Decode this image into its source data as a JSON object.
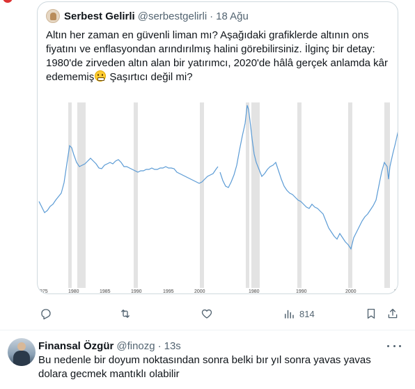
{
  "quoted_tweet": {
    "display_name": "Serbest Gelirli",
    "handle": "@serbestgelirli",
    "separator": "·",
    "date": "18 Ağu",
    "text_part1": "Altın her zaman en güvenli liman mı? Aşağıdaki grafiklerde altının ons fiyatını ve enflasyondan arındırılmış halini görebilirsiniz. İlginç bir detay: 1980'de zirveden altın alan bir yatırımcı, 2020'de hâlâ gerçek anlamda kâr edememiş",
    "emoji": "grimacing-face-emoji",
    "text_part2": " Şaşırtıcı değil mi?",
    "media": {
      "left_axis_labels": [
        "975",
        "1980",
        "1985",
        "1990",
        "1995",
        "2000"
      ],
      "right_axis_labels": [
        "1980",
        "1990",
        "2000",
        "2"
      ],
      "line_color": "#5b9bd5",
      "band_color": "#e3e3e3"
    }
  },
  "actions": {
    "reply_icon": "reply-icon",
    "retweet_icon": "retweet-icon",
    "like_icon": "heart-icon",
    "views_icon": "views-icon",
    "views_count": "814",
    "bookmark_icon": "bookmark-icon",
    "share_icon": "share-icon"
  },
  "reply": {
    "display_name": "Finansal Özgür",
    "handle": "@finozg",
    "separator": "·",
    "time": "13s",
    "text": "Bu nedenle bir doyum noktasından sonra belki bır yıl sonra yavas yavas dolara gecmek mantıklı olabilir"
  }
}
